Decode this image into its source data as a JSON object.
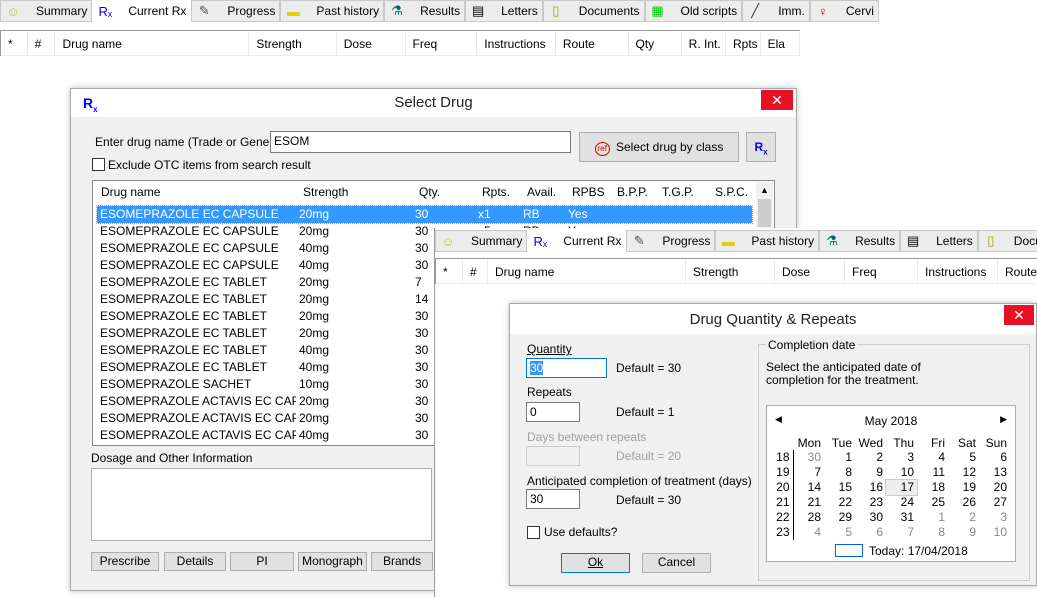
{
  "back_window": {
    "tabs": [
      {
        "label": "Summary",
        "icon": "smiley-icon"
      },
      {
        "label": "Current Rx",
        "icon": "rx-icon"
      },
      {
        "label": "Progress",
        "icon": "progress-icon"
      },
      {
        "label": "Past history",
        "icon": "folder-icon"
      },
      {
        "label": "Results",
        "icon": "microscope-icon"
      },
      {
        "label": "Letters",
        "icon": "letter-icon"
      },
      {
        "label": "Documents",
        "icon": "documents-icon"
      },
      {
        "label": "Old scripts",
        "icon": "old-scripts-icon"
      },
      {
        "label": "Imm.",
        "icon": "syringe-icon"
      },
      {
        "label": "Cervi",
        "icon": "female-icon"
      }
    ],
    "columns": [
      "*",
      "#",
      "Drug name",
      "Strength",
      "Dose",
      "Freq",
      "Instructions",
      "Route",
      "Qty",
      "R. Int.",
      "Rpts",
      "Ela"
    ]
  },
  "select_drug": {
    "title": "Select Drug",
    "enter_label": "Enter drug name (Trade or Generic )",
    "drug_input": "ESOM",
    "exclude_otc": "Exclude OTC items from search result",
    "select_by_class": "Select drug by class",
    "ref_icon": "ref",
    "columns": [
      "Drug name",
      "Strength",
      "Qty.",
      "Rpts.",
      "Avail.",
      "RPBS",
      "B.P.P.",
      "T.G.P.",
      "S.P.C."
    ],
    "rows": [
      [
        "ESOMEPRAZOLE EC CAPSULE",
        "20mg",
        "30",
        "x1",
        "RB",
        "Yes"
      ],
      [
        "ESOMEPRAZOLE EC CAPSULE",
        "20mg",
        "30",
        "x5",
        "RB",
        "Yes"
      ],
      [
        "ESOMEPRAZOLE EC CAPSULE",
        "40mg",
        "30"
      ],
      [
        "ESOMEPRAZOLE EC CAPSULE",
        "40mg",
        "30"
      ],
      [
        "ESOMEPRAZOLE EC TABLET",
        "20mg",
        "7"
      ],
      [
        "ESOMEPRAZOLE EC TABLET",
        "20mg",
        "14"
      ],
      [
        "ESOMEPRAZOLE EC TABLET",
        "20mg",
        "30"
      ],
      [
        "ESOMEPRAZOLE EC TABLET",
        "20mg",
        "30"
      ],
      [
        "ESOMEPRAZOLE EC TABLET",
        "40mg",
        "30"
      ],
      [
        "ESOMEPRAZOLE EC TABLET",
        "40mg",
        "30"
      ],
      [
        "ESOMEPRAZOLE SACHET",
        "10mg",
        "30"
      ],
      [
        "ESOMEPRAZOLE ACTAVIS EC CAPS...",
        "20mg",
        "30"
      ],
      [
        "ESOMEPRAZOLE ACTAVIS EC CAPS...",
        "20mg",
        "30"
      ],
      [
        "ESOMEPRAZOLE ACTAVIS EC CAPS...",
        "40mg",
        "30"
      ]
    ],
    "dosage_label": "Dosage and Other Information",
    "buttons": [
      "Prescribe",
      "Details",
      "PI",
      "Monograph",
      "Brands"
    ]
  },
  "front_window": {
    "tabs": [
      {
        "label": "Summary",
        "icon": "smiley-icon"
      },
      {
        "label": "Current Rx",
        "icon": "rx-icon"
      },
      {
        "label": "Progress",
        "icon": "progress-icon"
      },
      {
        "label": "Past history",
        "icon": "folder-icon"
      },
      {
        "label": "Results",
        "icon": "microscope-icon"
      },
      {
        "label": "Letters",
        "icon": "letter-icon"
      },
      {
        "label": "Documents",
        "icon": "documents-icon"
      }
    ],
    "columns": [
      "*",
      "#",
      "Drug name",
      "Strength",
      "Dose",
      "Freq",
      "Instructions",
      "Route"
    ]
  },
  "qty_dialog": {
    "title": "Drug Quantity & Repeats",
    "quantity_label": "Quantity",
    "quantity": "30",
    "quantity_default": "Default = 30",
    "repeats_label": "Repeats",
    "repeats": "0",
    "repeats_default": "Default = 1",
    "days_label": "Days between repeats",
    "days": "",
    "days_default": "Default = 20",
    "completion_label": "Anticipated completion of treatment (days)",
    "completion": "30",
    "completion_default": "Default = 30",
    "use_defaults": "Use defaults?",
    "ok": "Ok",
    "cancel": "Cancel",
    "group_label": "Completion date",
    "instructions": "Select the anticipated date of completion for the treatment.",
    "calendar": {
      "month": "May 2018",
      "days": [
        "Mon",
        "Tue",
        "Wed",
        "Thu",
        "Fri",
        "Sat",
        "Sun"
      ],
      "weeks": [
        {
          "wk": "18",
          "d": [
            "30",
            "1",
            "2",
            "3",
            "4",
            "5",
            "6"
          ]
        },
        {
          "wk": "19",
          "d": [
            "7",
            "8",
            "9",
            "10",
            "11",
            "12",
            "13"
          ]
        },
        {
          "wk": "20",
          "d": [
            "14",
            "15",
            "16",
            "17",
            "18",
            "19",
            "20"
          ]
        },
        {
          "wk": "21",
          "d": [
            "21",
            "22",
            "23",
            "24",
            "25",
            "26",
            "27"
          ]
        },
        {
          "wk": "22",
          "d": [
            "28",
            "29",
            "30",
            "31",
            "1",
            "2",
            "3"
          ]
        },
        {
          "wk": "23",
          "d": [
            "4",
            "5",
            "6",
            "7",
            "8",
            "9",
            "10"
          ]
        }
      ],
      "selected": "17",
      "today": "Today: 17/04/2018"
    }
  },
  "colors": {
    "selection": "#3399ff",
    "close": "#e81123",
    "rx": "#0000ff"
  }
}
